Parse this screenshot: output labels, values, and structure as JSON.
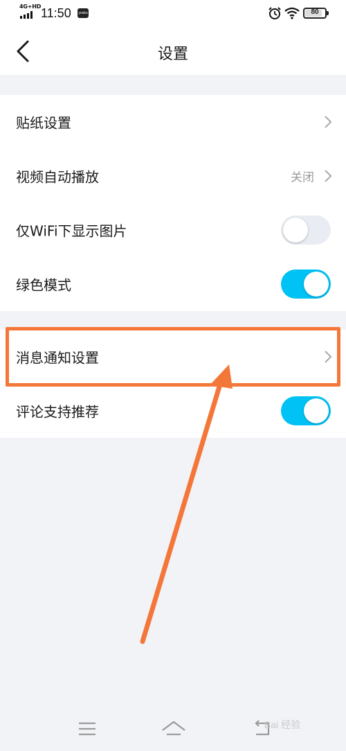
{
  "status_bar": {
    "network": "4G+HD",
    "time": "11:50",
    "app_icon_text": "youku",
    "battery": "80",
    "battery_level": 0.8
  },
  "header": {
    "title": "设置"
  },
  "settings_group_1": [
    {
      "label": "贴纸设置",
      "type": "chevron"
    },
    {
      "label": "视频自动播放",
      "type": "value-chevron",
      "value": "关闭"
    },
    {
      "label": "仅WiFi下显示图片",
      "type": "toggle",
      "on": false
    },
    {
      "label": "绿色模式",
      "type": "toggle",
      "on": true
    }
  ],
  "settings_group_2": [
    {
      "label": "消息通知设置",
      "type": "chevron"
    },
    {
      "label": "评论支持推荐",
      "type": "toggle",
      "on": true
    }
  ],
  "colors": {
    "toggle_on": "#00c2f5",
    "toggle_off": "#e9ecf2",
    "annotation": "#f4773a",
    "background": "#f2f3f7"
  },
  "watermark": "Bai 经验"
}
